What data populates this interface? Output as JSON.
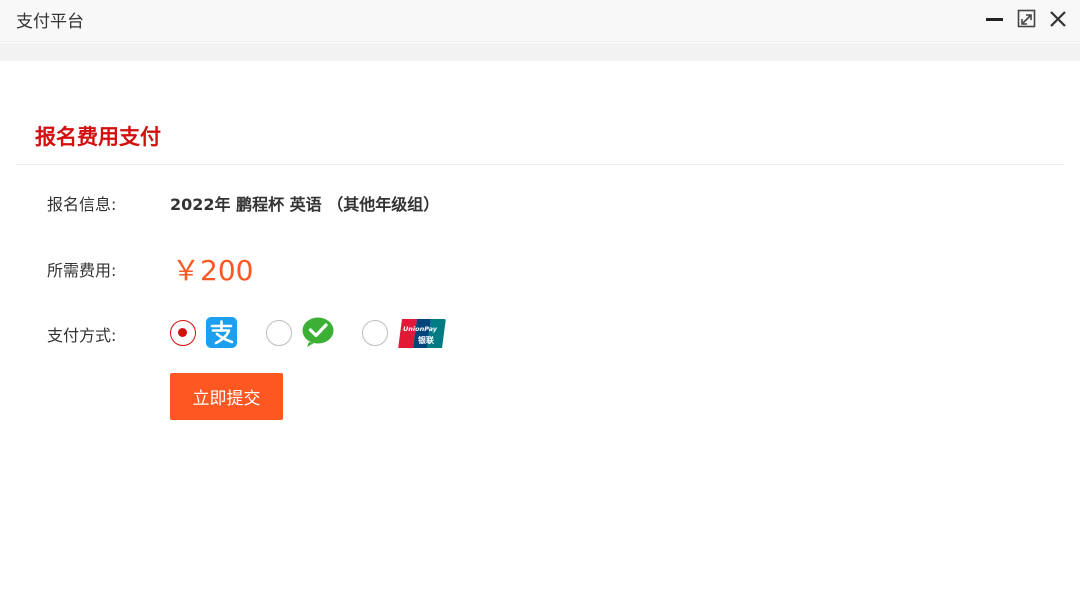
{
  "window": {
    "title": "支付平台",
    "controls": [
      "minimize-icon",
      "maximize-icon",
      "close-icon"
    ]
  },
  "page": {
    "section_title": "报名费用支付"
  },
  "form": {
    "info_label": "报名信息:",
    "info_value": "2022年 鹏程杯 英语 （其他年级组）",
    "fee_label": "所需费用:",
    "fee_value": "￥200",
    "method_label": "支付方式:",
    "methods": [
      {
        "icon": "alipay-icon",
        "selected": true
      },
      {
        "icon": "wechat-pay-icon",
        "selected": false
      },
      {
        "icon": "unionpay-icon",
        "selected": false
      }
    ],
    "unionpay_text": "UnionPay",
    "unionpay_cn": "银联",
    "submit_label": "立即提交"
  },
  "colors": {
    "accent_red": "#d40f0f",
    "price_orange": "#ff5722",
    "button_orange": "#ff5722",
    "alipay_blue": "#1d9ff0",
    "wechat_green": "#3cb034"
  }
}
